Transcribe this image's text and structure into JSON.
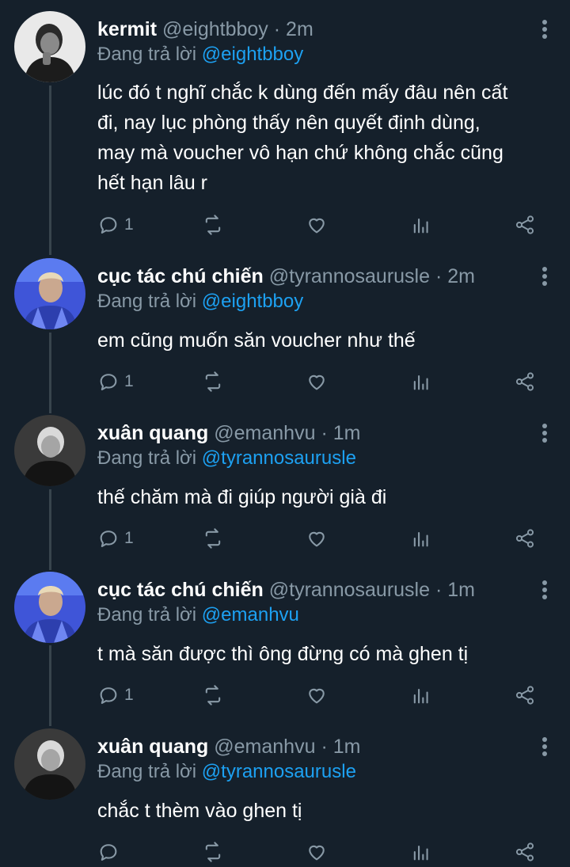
{
  "tweets": [
    {
      "name": "kermit",
      "handle": "@eightbboy",
      "sep": "·",
      "time": "2m",
      "reply_prefix": "Đang trả lời",
      "reply_to": "@eightbboy",
      "lines": [
        "lúc đó t nghĩ chắc k dùng đến mấy đâu nên cất",
        "đi, nay lục phòng thấy nên quyết định dùng,",
        "may mà voucher vô hạn chứ không chắc cũng",
        "hết hạn lâu r"
      ],
      "reply_count": "1",
      "avatar_icon": "person-portrait-dark-icon"
    },
    {
      "name": "cục tác chú chiến",
      "handle": "@tyrannosaurusle",
      "sep": "·",
      "time": "2m",
      "reply_prefix": "Đang trả lời",
      "reply_to": "@eightbboy",
      "lines": [
        "em cũng muốn săn voucher như thế"
      ],
      "reply_count": "1",
      "avatar_icon": "person-portrait-blue-icon"
    },
    {
      "name": "xuân quang",
      "handle": "@emanhvu",
      "sep": "·",
      "time": "1m",
      "reply_prefix": "Đang trả lời",
      "reply_to": "@tyrannosaurusle",
      "lines": [
        "thế chăm mà đi giúp người già đi"
      ],
      "reply_count": "1",
      "avatar_icon": "person-portrait-gray-icon"
    },
    {
      "name": "cục tác chú chiến",
      "handle": "@tyrannosaurusle",
      "sep": "·",
      "time": "1m",
      "reply_prefix": "Đang trả lời",
      "reply_to": "@emanhvu",
      "lines": [
        "t mà săn được thì ông đừng có mà ghen tị"
      ],
      "reply_count": "1",
      "avatar_icon": "person-portrait-blue-icon"
    },
    {
      "name": "xuân quang",
      "handle": "@emanhvu",
      "sep": "·",
      "time": "1m",
      "reply_prefix": "Đang trả lời",
      "reply_to": "@tyrannosaurusle",
      "lines": [
        "chắc t thèm vào ghen tị"
      ],
      "reply_count": "",
      "avatar_icon": "person-portrait-gray-icon"
    }
  ],
  "icons": {
    "reply": "reply-bubble-icon",
    "retweet": "retweet-icon",
    "like": "heart-icon",
    "analytics": "analytics-bars-icon",
    "share": "share-icon",
    "more": "more-vertical-icon"
  },
  "colors": {
    "background": "#15202b",
    "text": "#ffffff",
    "muted": "#8899a6",
    "mention": "#1da1f2",
    "thread_line": "#38444d"
  }
}
